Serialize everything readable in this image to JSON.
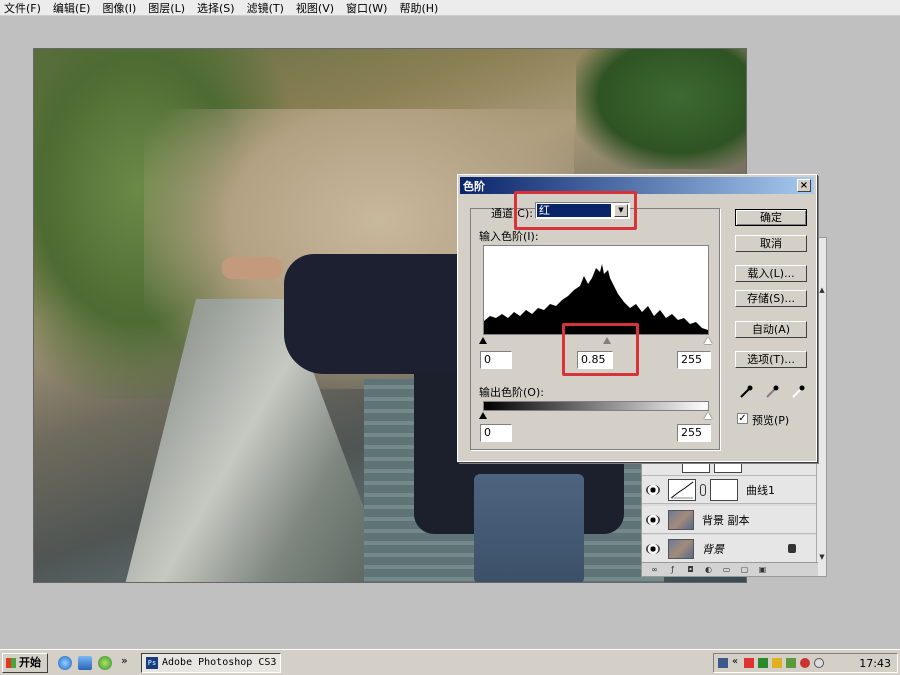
{
  "menubar": {
    "items": [
      {
        "label": "文件(F)"
      },
      {
        "label": "编辑(E)"
      },
      {
        "label": "图像(I)"
      },
      {
        "label": "图层(L)"
      },
      {
        "label": "选择(S)"
      },
      {
        "label": "滤镜(T)"
      },
      {
        "label": "视图(V)"
      },
      {
        "label": "窗口(W)"
      },
      {
        "label": "帮助(H)"
      }
    ]
  },
  "levels_dialog": {
    "title": "色阶",
    "channel_label": "通道(C):",
    "channel_value": "红",
    "input_levels_label": "输入色阶(I):",
    "input_black": "0",
    "input_gamma": "0.85",
    "input_white": "255",
    "output_levels_label": "输出色阶(O):",
    "output_black": "0",
    "output_white": "255",
    "buttons": {
      "ok": "确定",
      "cancel": "取消",
      "load": "载入(L)...",
      "save": "存储(S)...",
      "auto": "自动(A)",
      "options": "选项(T)..."
    },
    "preview_label": "预览(P)",
    "preview_checked": true
  },
  "layers_panel": {
    "layers": [
      {
        "name": "曲线1",
        "type": "adjustment"
      },
      {
        "name": "背景 副本",
        "type": "pixel"
      },
      {
        "name": "背景",
        "type": "background",
        "locked": true
      }
    ]
  },
  "taskbar": {
    "start_label": "开始",
    "task_label": "Adobe Photoshop CS3",
    "overflow": "»",
    "tray_overflow": "«",
    "clock": "17:43"
  },
  "colors": {
    "highlight": "#d8333a",
    "titlebar_start": "#0a246a",
    "titlebar_end": "#a6caf0"
  }
}
